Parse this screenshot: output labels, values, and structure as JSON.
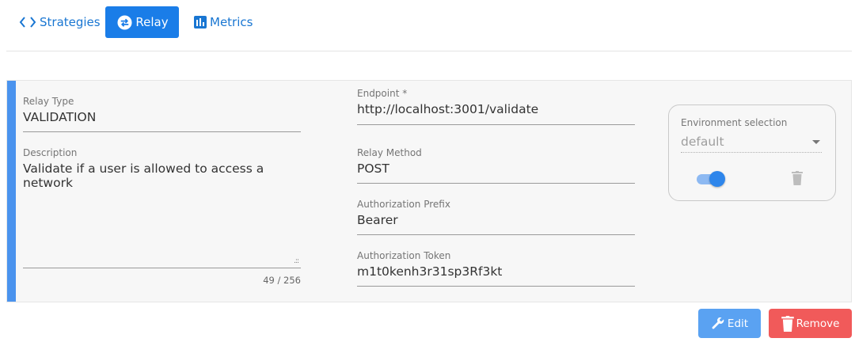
{
  "tabs": {
    "strategies": "Strategies",
    "relay": "Relay",
    "metrics": "Metrics"
  },
  "relay": {
    "type_label": "Relay Type",
    "type_value": "VALIDATION",
    "description_label": "Description",
    "description_value": "Validate if a user is allowed to access a network",
    "description_counter": "49 / 256",
    "endpoint_label": "Endpoint *",
    "endpoint_value": "http://localhost:3001/validate",
    "method_label": "Relay Method",
    "method_value": "POST",
    "auth_prefix_label": "Authorization Prefix",
    "auth_prefix_value": "Bearer",
    "auth_token_label": "Authorization Token",
    "auth_token_value": "m1t0kenh3r31sp3Rf3kt"
  },
  "environment": {
    "label": "Environment selection",
    "selected": "default",
    "enabled": true
  },
  "actions": {
    "edit": "Edit",
    "remove": "Remove"
  },
  "icons": {
    "strategies": "code-brackets-icon",
    "relay": "swap-circle-icon",
    "metrics": "bar-chart-icon",
    "edit": "wrench-icon",
    "remove": "trash-icon",
    "env_delete": "trash-icon"
  },
  "colors": {
    "accent": "#1a7de8",
    "card_accent": "#4a93ee",
    "edit_button": "#5aa2f2",
    "remove_button": "#f15a5a"
  }
}
